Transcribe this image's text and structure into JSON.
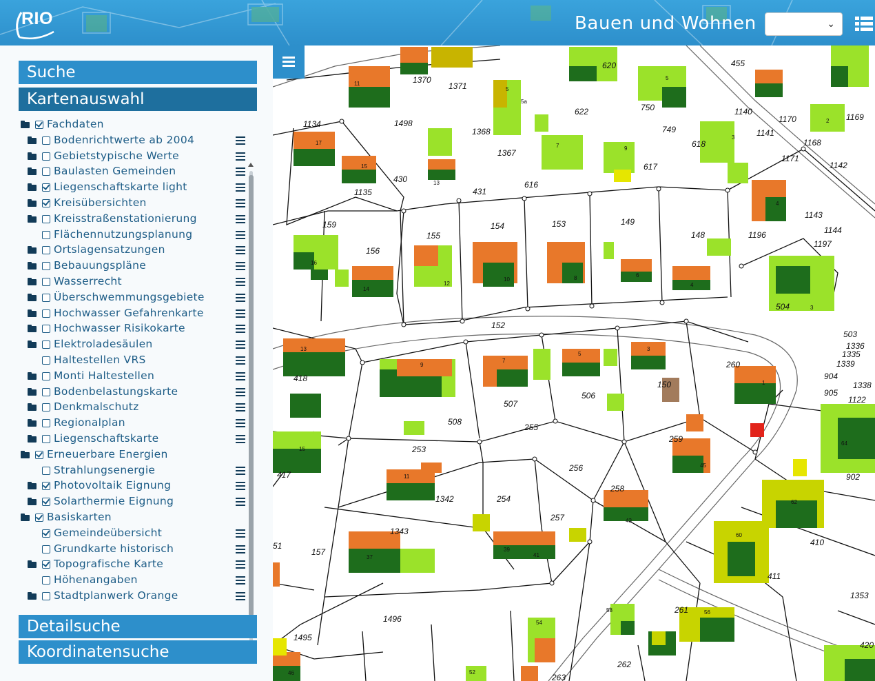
{
  "header": {
    "logo_text": "RIO",
    "app_title": "Bauen und Wohnen",
    "theme_select_value": ""
  },
  "sidebar": {
    "panels": {
      "search": "Suche",
      "map_selection": "Kartenauswahl",
      "detail_search": "Detailsuche",
      "coordinate_search": "Koordinatensuche"
    },
    "layers": [
      {
        "label": "Fachdaten",
        "level": 0,
        "folder": true,
        "checked": true,
        "menu": false
      },
      {
        "label": "Bodenrichtwerte ab 2004",
        "level": 1,
        "folder": true,
        "checked": false,
        "menu": true
      },
      {
        "label": "Gebietstypische Werte",
        "level": 1,
        "folder": true,
        "checked": false,
        "menu": true
      },
      {
        "label": "Baulasten Gemeinden",
        "level": 1,
        "folder": true,
        "checked": false,
        "menu": true
      },
      {
        "label": "Liegenschaftskarte light",
        "level": 1,
        "folder": true,
        "checked": true,
        "menu": true
      },
      {
        "label": "Kreisübersichten",
        "level": 1,
        "folder": true,
        "checked": true,
        "menu": true
      },
      {
        "label": "Kreisstraßenstationierung",
        "level": 1,
        "folder": true,
        "checked": false,
        "menu": true
      },
      {
        "label": "Flächennutzungsplanung",
        "level": 1,
        "folder": false,
        "checked": false,
        "menu": true
      },
      {
        "label": "Ortslagensatzungen",
        "level": 1,
        "folder": true,
        "checked": false,
        "menu": true
      },
      {
        "label": "Bebauungspläne",
        "level": 1,
        "folder": true,
        "checked": false,
        "menu": true
      },
      {
        "label": "Wasserrecht",
        "level": 1,
        "folder": true,
        "checked": false,
        "menu": true
      },
      {
        "label": "Überschwemmungsgebiete",
        "level": 1,
        "folder": true,
        "checked": false,
        "menu": true
      },
      {
        "label": "Hochwasser Gefahrenkarte",
        "level": 1,
        "folder": true,
        "checked": false,
        "menu": true
      },
      {
        "label": "Hochwasser Risikokarte",
        "level": 1,
        "folder": true,
        "checked": false,
        "menu": true
      },
      {
        "label": "Elektroladesäulen",
        "level": 1,
        "folder": true,
        "checked": false,
        "menu": true
      },
      {
        "label": "Haltestellen VRS",
        "level": 1,
        "folder": false,
        "checked": false,
        "menu": true
      },
      {
        "label": "Monti Haltestellen",
        "level": 1,
        "folder": true,
        "checked": false,
        "menu": true
      },
      {
        "label": "Bodenbelastungskarte",
        "level": 1,
        "folder": true,
        "checked": false,
        "menu": true
      },
      {
        "label": "Denkmalschutz",
        "level": 1,
        "folder": true,
        "checked": false,
        "menu": true
      },
      {
        "label": "Regionalplan",
        "level": 1,
        "folder": true,
        "checked": false,
        "menu": true
      },
      {
        "label": "Liegenschaftskarte",
        "level": 1,
        "folder": true,
        "checked": false,
        "menu": true
      },
      {
        "label": "Erneuerbare Energien",
        "level": 0,
        "folder": true,
        "checked": true,
        "menu": false
      },
      {
        "label": "Strahlungsenergie",
        "level": 1,
        "folder": false,
        "checked": false,
        "menu": true
      },
      {
        "label": "Photovoltaik Eignung",
        "level": 1,
        "folder": true,
        "checked": true,
        "menu": true
      },
      {
        "label": "Solarthermie Eignung",
        "level": 1,
        "folder": true,
        "checked": true,
        "menu": true
      },
      {
        "label": "Basiskarten",
        "level": 0,
        "folder": true,
        "checked": true,
        "menu": false
      },
      {
        "label": "Gemeindeübersicht",
        "level": 1,
        "folder": false,
        "checked": true,
        "menu": true
      },
      {
        "label": "Grundkarte historisch",
        "level": 1,
        "folder": false,
        "checked": false,
        "menu": true
      },
      {
        "label": "Topografische Karte",
        "level": 1,
        "folder": true,
        "checked": true,
        "menu": true
      },
      {
        "label": "Höhenangaben",
        "level": 1,
        "folder": false,
        "checked": false,
        "menu": true
      },
      {
        "label": "Stadtplanwerk Orange",
        "level": 1,
        "folder": true,
        "checked": false,
        "menu": true
      }
    ]
  },
  "map": {
    "parcel_labels": [
      "1370",
      "1371",
      "620",
      "455",
      "1134",
      "1498",
      "1368",
      "622",
      "750",
      "1140",
      "1170",
      "1169",
      "749",
      "1141",
      "1168",
      "618",
      "1171",
      "1142",
      "617",
      "1367",
      "616",
      "430",
      "431",
      "1135",
      "159",
      "155",
      "154",
      "153",
      "149",
      "148",
      "1196",
      "1143",
      "1144",
      "1197",
      "156",
      "504",
      "503",
      "152",
      "1336",
      "1335",
      "1339",
      "418",
      "507",
      "506",
      "150",
      "260",
      "904",
      "1338",
      "905",
      "1122",
      "508",
      "255",
      "259",
      "253",
      "256",
      "902",
      "417",
      "1342",
      "254",
      "258",
      "257",
      "410",
      "1343",
      "51",
      "157",
      "411",
      "1353",
      "261",
      "1496",
      "1495",
      "262",
      "263",
      "420"
    ],
    "house_numbers": [
      "11",
      "5a",
      "5",
      "17",
      "15",
      "13",
      "7",
      "9",
      "2",
      "3",
      "4",
      "16",
      "14",
      "12",
      "10",
      "8",
      "6",
      "4",
      "3",
      "9",
      "7",
      "5",
      "3",
      "1",
      "15",
      "11",
      "45",
      "64",
      "62",
      "60",
      "43",
      "39",
      "41",
      "37",
      "58",
      "56",
      "54",
      "52",
      "46"
    ],
    "colors": {
      "panel_blue": "#2d8fcb",
      "panel_blue_dark": "#1e6f9e",
      "pv_light_green": "#9be22a",
      "pv_dark_green": "#1e6d1c",
      "pv_orange": "#e8782a",
      "pv_red": "#e2231a"
    }
  }
}
